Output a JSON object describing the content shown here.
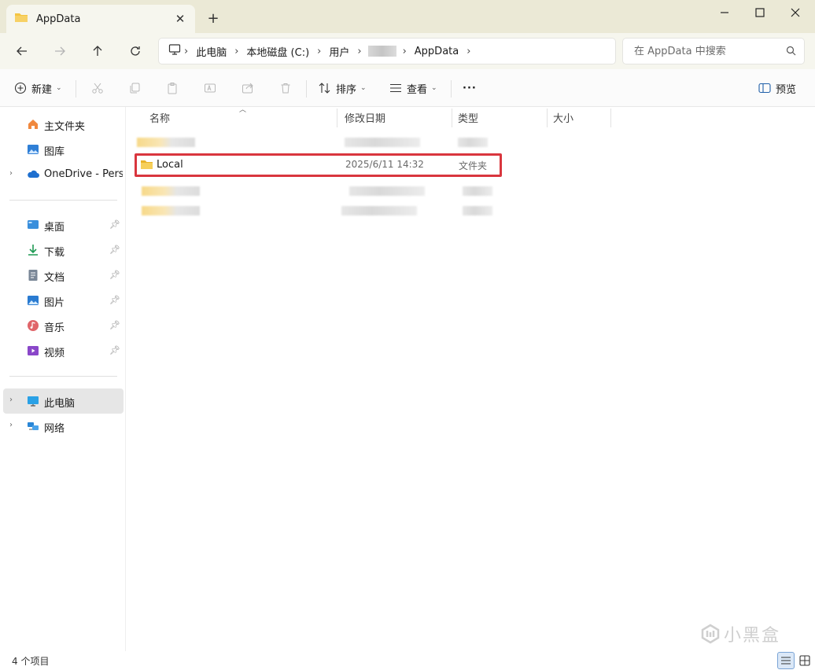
{
  "window": {
    "tab_title": "AppData",
    "close_tab_symbol": "✕",
    "new_tab_symbol": "+"
  },
  "address": {
    "crumbs": [
      "此电脑",
      "本地磁盘 (C:)",
      "用户",
      "AppData"
    ],
    "search_placeholder": "在 AppData 中搜索"
  },
  "toolbar": {
    "new_label": "新建",
    "sort_label": "排序",
    "view_label": "查看",
    "more_symbol": "···",
    "preview_label": "预览"
  },
  "sidebar": {
    "top": [
      {
        "label": "主文件夹",
        "icon": "home-icon"
      },
      {
        "label": "图库",
        "icon": "gallery-icon"
      },
      {
        "label": "OneDrive - Perso",
        "icon": "cloud-icon"
      }
    ],
    "quick": [
      {
        "label": "桌面",
        "icon": "desktop-icon"
      },
      {
        "label": "下载",
        "icon": "download-icon"
      },
      {
        "label": "文档",
        "icon": "documents-icon"
      },
      {
        "label": "图片",
        "icon": "pictures-icon"
      },
      {
        "label": "音乐",
        "icon": "music-icon"
      },
      {
        "label": "视频",
        "icon": "video-icon"
      }
    ],
    "bottom": [
      {
        "label": "此电脑",
        "icon": "this-pc-icon"
      },
      {
        "label": "网络",
        "icon": "network-icon"
      }
    ]
  },
  "columns": {
    "name": "名称",
    "date": "修改日期",
    "type": "类型",
    "size": "大小"
  },
  "files": {
    "highlighted": {
      "name": "Local",
      "date": "2025/6/11 14:32",
      "type": "文件夹"
    }
  },
  "status": {
    "count_text": "4 个项目"
  },
  "watermark": {
    "text": "小黑盒"
  },
  "colors": {
    "titlebar": "#ebe9d6",
    "highlight_border": "#d9363e",
    "folder": "#f4c542"
  }
}
